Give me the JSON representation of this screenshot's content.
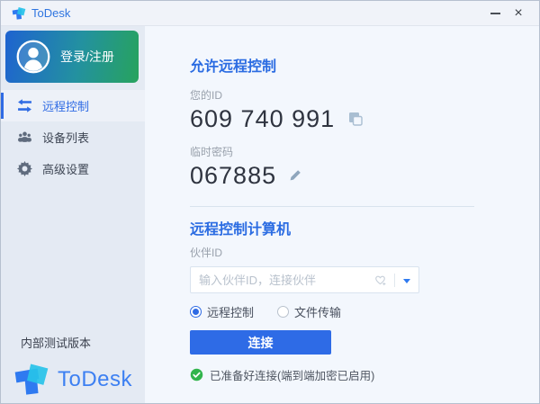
{
  "window": {
    "title": "ToDesk",
    "close_glyph": "×"
  },
  "sidebar": {
    "login_label": "登录/注册",
    "nav": [
      {
        "label": "远程控制",
        "active": true
      },
      {
        "label": "设备列表",
        "active": false
      },
      {
        "label": "高级设置",
        "active": false
      }
    ],
    "version_label": "内部测试版本",
    "brand": "ToDesk"
  },
  "main": {
    "allow": {
      "title": "允许远程控制",
      "id_label": "您的ID",
      "id_value": "609 740 991",
      "password_label": "临时密码",
      "password_value": "067885"
    },
    "connect": {
      "title": "远程控制计算机",
      "partner_label": "伙伴ID",
      "input_placeholder": "输入伙伴ID，连接伙伴",
      "input_value": "",
      "options": [
        {
          "label": "远程控制",
          "selected": true
        },
        {
          "label": "文件传输",
          "selected": false
        }
      ],
      "button": "连接",
      "status": "已准备好连接(端到端加密已启用)"
    }
  },
  "colors": {
    "accent_blue": "#2e6be6",
    "heading_blue": "#2b6ce2",
    "brand_blue": "#2f7af0",
    "brand_cyan": "#27c2e9",
    "success_green": "#31b44c",
    "login_gradient_start": "#1e63d0",
    "login_gradient_end": "#27a35d",
    "sidebar_bg": "#e4eaf3",
    "main_bg": "#f3f7fd"
  }
}
